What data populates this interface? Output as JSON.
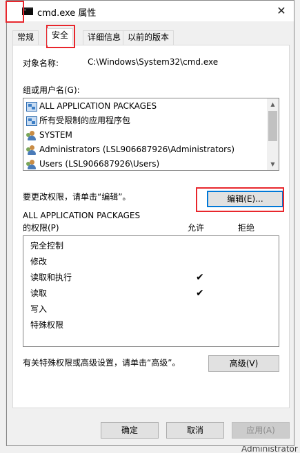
{
  "window": {
    "title": "cmd.exe 属性",
    "close_icon": "close-icon"
  },
  "tabs": [
    {
      "label": "常规"
    },
    {
      "label": "安全",
      "active": true
    },
    {
      "label": "详细信息"
    },
    {
      "label": "以前的版本"
    }
  ],
  "security": {
    "object_name_label": "对象名称:",
    "object_name_value": "C:\\Windows\\System32\\cmd.exe",
    "group_label": "组或用户名(G):",
    "users": [
      {
        "name": "ALL APPLICATION PACKAGES",
        "icon": "package-icon"
      },
      {
        "name": "所有受限制的应用程序包",
        "icon": "package-icon"
      },
      {
        "name": "SYSTEM",
        "icon": "users-icon"
      },
      {
        "name": "Administrators (LSL906687926\\Administrators)",
        "icon": "users-icon"
      },
      {
        "name": "Users (LSL906687926\\Users)",
        "icon": "users-icon"
      }
    ],
    "change_hint": "要更改权限，请单击“编辑”。",
    "edit_button": "编辑(E)...",
    "perm_group_name": "ALL APPLICATION PACKAGES",
    "perm_label": "的权限(P)",
    "allow_label": "允许",
    "deny_label": "拒绝",
    "permissions": [
      {
        "name": "完全控制",
        "allow": false
      },
      {
        "name": "修改",
        "allow": false
      },
      {
        "name": "读取和执行",
        "allow": true
      },
      {
        "name": "读取",
        "allow": true
      },
      {
        "name": "写入",
        "allow": false
      },
      {
        "name": "特殊权限",
        "allow": false
      }
    ],
    "check_mark": "✔",
    "advanced_hint": "有关特殊权限或高级设置，请单击“高级”。",
    "advanced_button": "高级(V)"
  },
  "footer": {
    "ok": "确定",
    "cancel": "取消",
    "apply": "应用(A)"
  },
  "background": {
    "bottom_text": "Administrator"
  },
  "colors": {
    "highlight_box": "#e8262c",
    "focus_border": "#0078d7"
  }
}
